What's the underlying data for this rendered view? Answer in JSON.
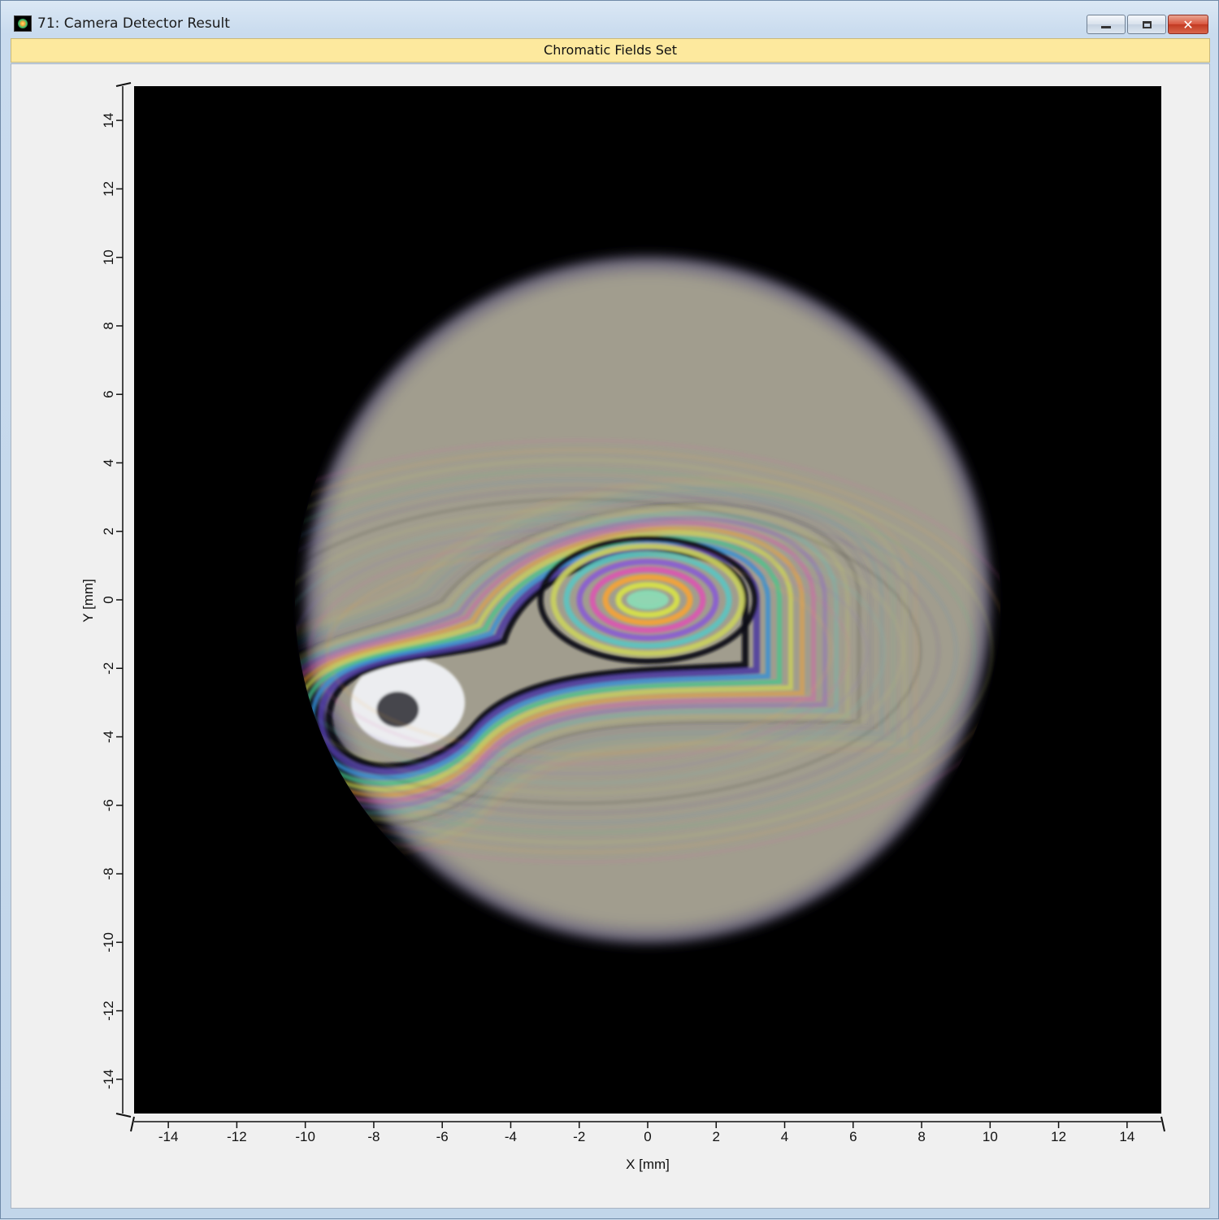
{
  "window": {
    "title": "71: Camera Detector Result",
    "icon": "camera-detector-icon",
    "controls": {
      "minimize": "minimize-icon",
      "restore": "restore-icon",
      "close": "close-icon"
    }
  },
  "banner": {
    "label": "Chromatic Fields Set",
    "color": "#fde99e"
  },
  "plot": {
    "type": "heatmap",
    "xlabel": "X [mm]",
    "ylabel": "Y [mm]",
    "xlim": [
      -15,
      15
    ],
    "ylim": [
      -15,
      15
    ],
    "x_ticks": [
      "-14",
      "-12",
      "-10",
      "-8",
      "-6",
      "-4",
      "-2",
      "0",
      "2",
      "4",
      "6",
      "8",
      "10",
      "12",
      "14"
    ],
    "y_ticks": [
      "14",
      "12",
      "10",
      "8",
      "6",
      "4",
      "2",
      "0",
      "-2",
      "-4",
      "-6",
      "-8",
      "-10",
      "-12",
      "-14"
    ]
  },
  "chart_data": {
    "type": "heatmap",
    "xlabel": "X [mm]",
    "ylabel": "Y [mm]",
    "xlim": [
      -15,
      15
    ],
    "ylim": [
      -15,
      15
    ],
    "x_ticks": [
      -14,
      -12,
      -10,
      -8,
      -6,
      -4,
      -2,
      0,
      2,
      4,
      6,
      8,
      10,
      12,
      14
    ],
    "y_ticks": [
      -14,
      -12,
      -10,
      -8,
      -6,
      -4,
      -2,
      0,
      2,
      4,
      6,
      8,
      10,
      12,
      14
    ],
    "grid": false,
    "background_color": "#000000",
    "field_color": "#a19d8e",
    "field_circle": {
      "center": [
        0,
        0
      ],
      "radius": 10
    },
    "fringe_centers": [
      {
        "x": 0,
        "y": 0
      },
      {
        "x": -7.3,
        "y": -3.2
      }
    ]
  }
}
